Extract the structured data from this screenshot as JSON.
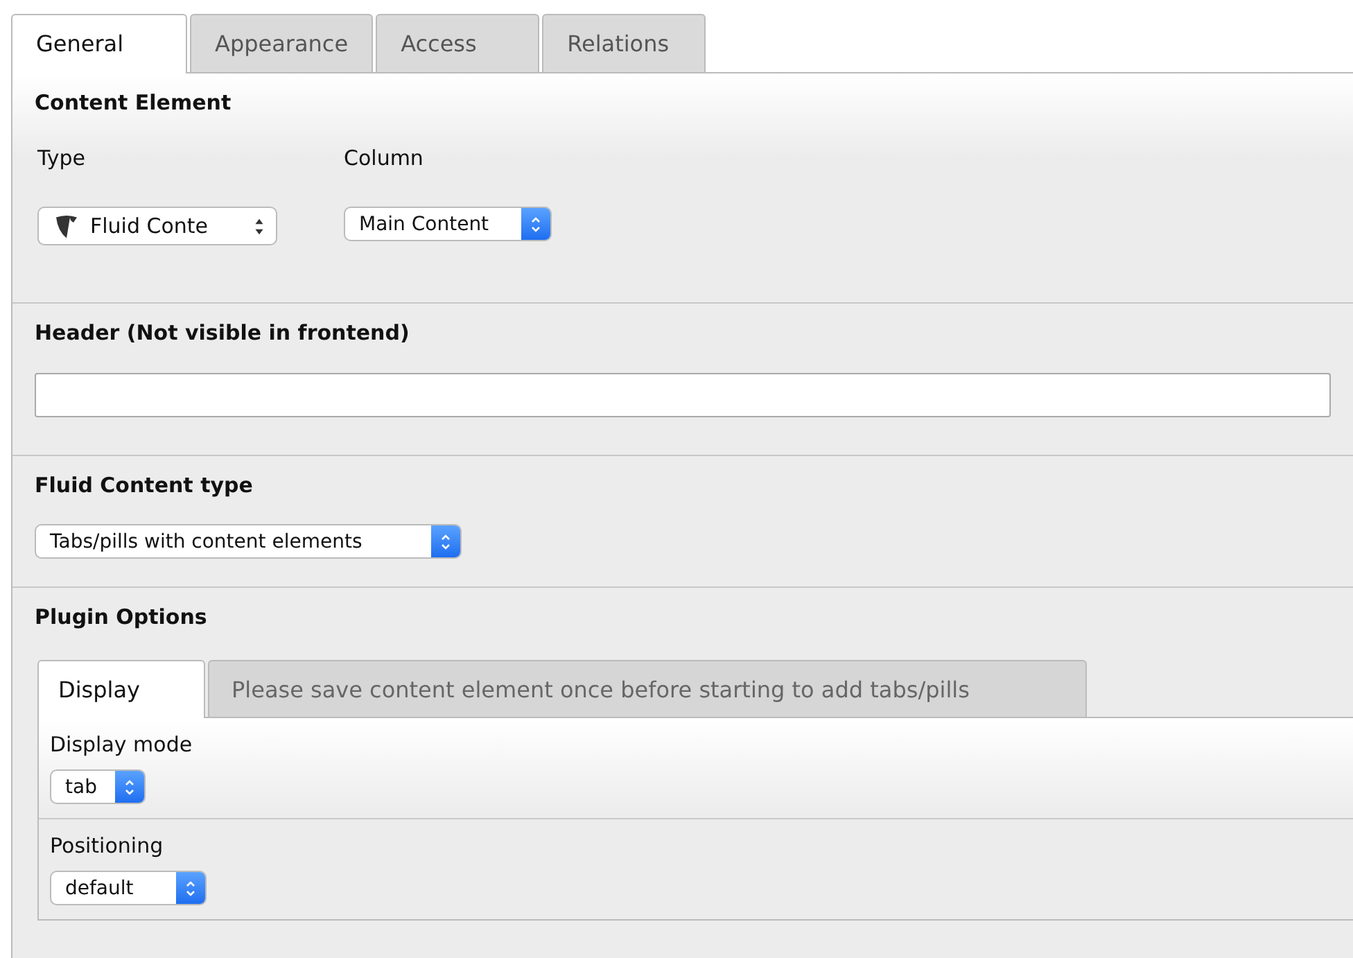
{
  "tabs": [
    {
      "label": "General",
      "selected": true
    },
    {
      "label": "Appearance",
      "selected": false
    },
    {
      "label": "Access",
      "selected": false
    },
    {
      "label": "Relations",
      "selected": false
    }
  ],
  "content_element": {
    "title": "Content Element",
    "fields": [
      {
        "label": "Type",
        "select": {
          "kind": "logo",
          "value": "Fluid Conte"
        }
      },
      {
        "label": "Column",
        "select": {
          "kind": "stepper",
          "value": "Main Content"
        }
      }
    ]
  },
  "header": {
    "label": "Header (Not visible in frontend)"
  },
  "fluid_content_type": {
    "title": "Fluid Content type",
    "select": {
      "kind": "stepper",
      "value": "Tabs/pills with content elements"
    }
  },
  "plugin_options": {
    "title": "Plugin Options",
    "tabs": [
      {
        "label": "Display",
        "selected": true
      },
      {
        "label": "Please save content element once before starting to add tabs/pills",
        "selected": false
      }
    ],
    "fields": [
      {
        "label": "Display mode",
        "select": {
          "kind": "stepper",
          "value": "tab"
        }
      },
      {
        "label": "Positioning",
        "select": {
          "kind": "stepper",
          "value": "default"
        }
      }
    ]
  }
}
